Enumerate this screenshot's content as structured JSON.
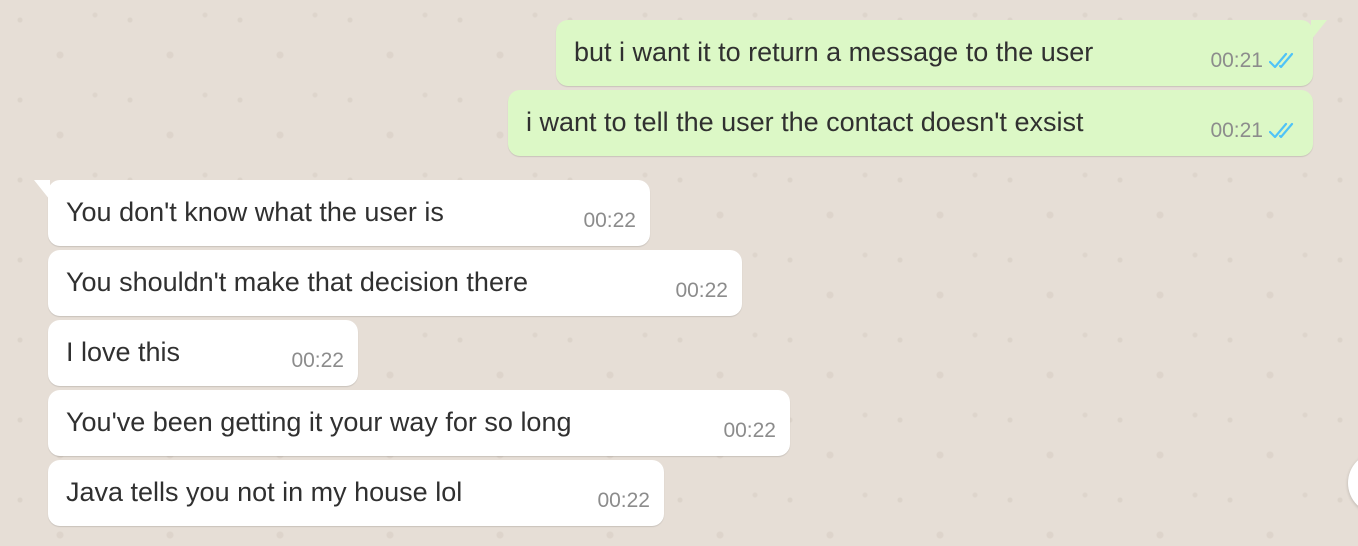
{
  "colors": {
    "chat_background": "#e6ded6",
    "outgoing_bubble": "#dcf8c6",
    "incoming_bubble": "#ffffff",
    "read_ticks": "#4fc3f7",
    "timestamp": "#8c8c8c"
  },
  "messages": [
    {
      "direction": "outgoing",
      "text": "but i want it to return a message to the user",
      "time": "00:21",
      "status_icon": "double-check-read-icon"
    },
    {
      "direction": "outgoing",
      "text": "i want to tell the user the contact doesn't exsist",
      "time": "00:21",
      "status_icon": "double-check-read-icon"
    },
    {
      "direction": "incoming",
      "text": "You don't know what the user is",
      "time": "00:22"
    },
    {
      "direction": "incoming",
      "text": "You shouldn't make that decision there",
      "time": "00:22"
    },
    {
      "direction": "incoming",
      "text": "I love this",
      "time": "00:22"
    },
    {
      "direction": "incoming",
      "text": "You've been getting it your way for so long",
      "time": "00:22"
    },
    {
      "direction": "incoming",
      "text": "Java tells you not in my house lol",
      "time": "00:22"
    }
  ]
}
